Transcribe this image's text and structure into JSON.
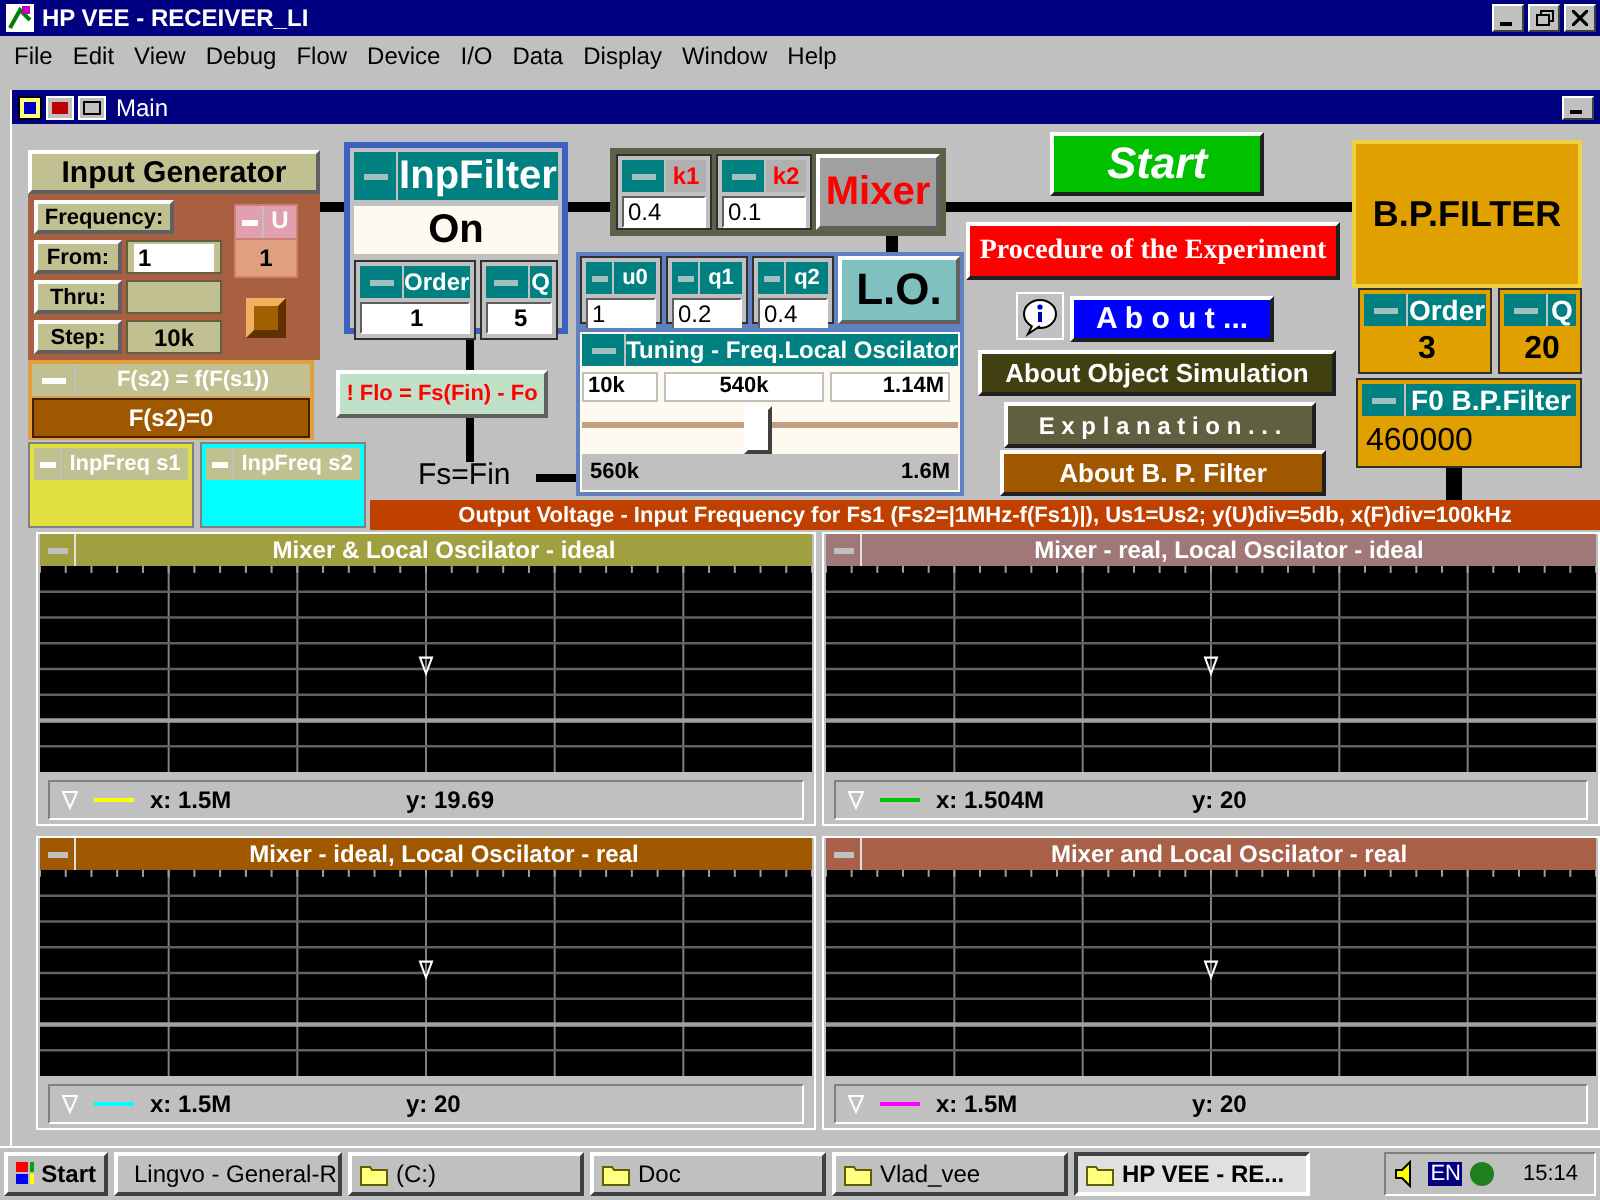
{
  "window": {
    "title": "HP VEE - RECEIVER_LI"
  },
  "menu": [
    "File",
    "Edit",
    "View",
    "Debug",
    "Flow",
    "Device",
    "I/O",
    "Data",
    "Display",
    "Window",
    "Help"
  ],
  "main": {
    "title": "Main"
  },
  "input_generator": {
    "title": "Input Generator",
    "frequency_label": "Frequency:",
    "from_label": "From:",
    "from_value": "1",
    "thru_label": "Thru:",
    "step_label": "Step:",
    "step_value": "10k",
    "u": {
      "label": "U",
      "value": "1"
    }
  },
  "function_box": {
    "title": "F(s2) = f(F(s1))",
    "value": "F(s2)=0"
  },
  "inp_freq": [
    {
      "label": "InpFreq s1",
      "color": "#e0e040"
    },
    {
      "label": "InpFreq s2",
      "color": "#00ffff"
    }
  ],
  "inp_filter": {
    "title": "InpFilter",
    "value": "On",
    "params": [
      {
        "label": "Order",
        "value": "1"
      },
      {
        "label": "Q",
        "value": "5"
      }
    ]
  },
  "mixer": {
    "label": "Mixer",
    "params": [
      {
        "label": "k1",
        "value": "0.4"
      },
      {
        "label": "k2",
        "value": "0.1"
      }
    ]
  },
  "oscillator": {
    "label": "L.O.",
    "params": [
      {
        "label": "u0",
        "value": "1"
      },
      {
        "label": "q1",
        "value": "0.2"
      },
      {
        "label": "q2",
        "value": "0.4"
      }
    ]
  },
  "tuning": {
    "title": "Tuning - Freq.Local Oscilator",
    "min": "10k",
    "value": "540k",
    "max": "1.14M",
    "level": 0.47,
    "range_min": "560k",
    "range_max": "1.6M"
  },
  "formula": "! Flo = Fs(Fin) - Fo",
  "fs_label": "Fs=Fin",
  "buttons": [
    {
      "kind": "start",
      "label": "Start"
    },
    {
      "kind": "procedure",
      "label": "Procedure of the Experiment"
    },
    {
      "kind": "about",
      "label": "A b o u t ..."
    },
    {
      "kind": "simulation",
      "label": "About Object Simulation"
    },
    {
      "kind": "explanation",
      "label": "E x p l a n a t i o n . . ."
    },
    {
      "kind": "bp",
      "label": "About B. P. Filter"
    }
  ],
  "bp_filter": {
    "title": "B.P.FILTER",
    "params": [
      {
        "label": "Order",
        "value": "3"
      },
      {
        "label": "Q",
        "value": "20"
      }
    ],
    "f0": {
      "label": "F0 B.P.Filter",
      "value": "460000"
    }
  },
  "banner": "Output Voltage - Input Frequency for Fs1 (Fs2=|1MHz-f(Fs1)|), Us1=Us2; y(U)div=5db, x(F)div=100kHz",
  "plots": [
    {
      "title": "Mixer & Local Oscilator - ideal",
      "color": "#a0a040",
      "legend": {
        "color": "#ffff00"
      },
      "x": "x: 1.5M",
      "y": "y: 19.69"
    },
    {
      "title": "Mixer - real, Local Oscilator - ideal",
      "color": "#a07878",
      "legend": {
        "color": "#00c000"
      },
      "x": "x: 1.504M",
      "y": "y: 20"
    },
    {
      "title": "Mixer - ideal, Local Oscilator - real",
      "color": "#a05800",
      "legend": {
        "color": "#00ffff"
      },
      "x": "x: 1.5M",
      "y": "y: 20"
    },
    {
      "title": "Mixer and Local Oscilator - real",
      "color": "#a86048",
      "legend": {
        "color": "#ff00ff"
      },
      "x": "x: 1.5M",
      "y": "y: 20"
    }
  ],
  "taskbar": {
    "start": "Start",
    "tasks": [
      {
        "label": "Lingvo - General-R",
        "selected": false
      },
      {
        "label": "(C:)",
        "selected": false
      },
      {
        "label": "Doc",
        "selected": false
      },
      {
        "label": "Vlad_vee",
        "selected": false
      },
      {
        "label": "HP VEE - RE...",
        "selected": true
      }
    ],
    "tray_lang": "EN",
    "clock": "15:14"
  }
}
